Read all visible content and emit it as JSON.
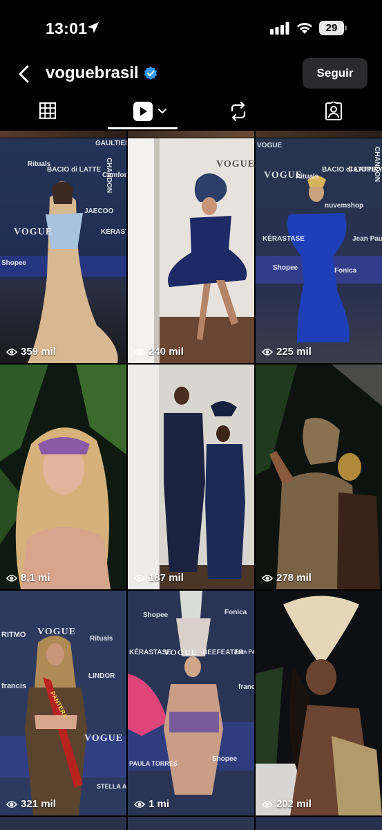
{
  "status_bar": {
    "time": "13:01",
    "battery": "29"
  },
  "header": {
    "username": "voguebrasil",
    "follow_label": "Seguir"
  },
  "tabs": [
    {
      "name": "grid-tab",
      "icon": "grid-icon"
    },
    {
      "name": "reels-tab",
      "icon": "reels-icon",
      "active": true
    },
    {
      "name": "reposts-tab",
      "icon": "repost-icon"
    },
    {
      "name": "tagged-tab",
      "icon": "tagged-person-icon"
    }
  ],
  "reels": [
    {
      "views": "359 mil"
    },
    {
      "views": "240 mil"
    },
    {
      "views": "225 mil"
    },
    {
      "views": "8,1 mi"
    },
    {
      "views": "187 mil"
    },
    {
      "views": "278 mil"
    },
    {
      "views": "321 mil"
    },
    {
      "views": "1 mi"
    },
    {
      "views": "202 mil"
    }
  ],
  "wall_text": {
    "t1": [
      "VOGUE",
      "Rituals",
      "BACIO di LATTE",
      "CHANDON",
      "Comfort",
      "Shopee",
      "JAECOO",
      "KÉRASTASE",
      "GAULTIER"
    ],
    "t3": [
      "VOGUE",
      "Rituals",
      "BACIO di LATTE",
      "CATUPIRY",
      "CHANDON",
      "nuvemshop",
      "Jean Paul GAULTIER",
      "Shopee",
      "KÉRASTASE",
      "Fonica",
      "VOGUE"
    ],
    "t7": [
      "RITMO",
      "VOGUE",
      "Rituals",
      "LINDOR",
      "francis",
      "VOGUE",
      "PANTERA",
      "STELLA ARTOIS"
    ],
    "t8": [
      "Shopee",
      "Fonica",
      "KÉRASTASE",
      "VOGUE",
      "BEEFEATER",
      "Jean Paul GAULTIER",
      "PAULA TORRES",
      "Shopee",
      "franc"
    ]
  },
  "colors": {
    "background": "#000000",
    "follow_button": "#2b2b2d",
    "verified": "#3797f0"
  }
}
